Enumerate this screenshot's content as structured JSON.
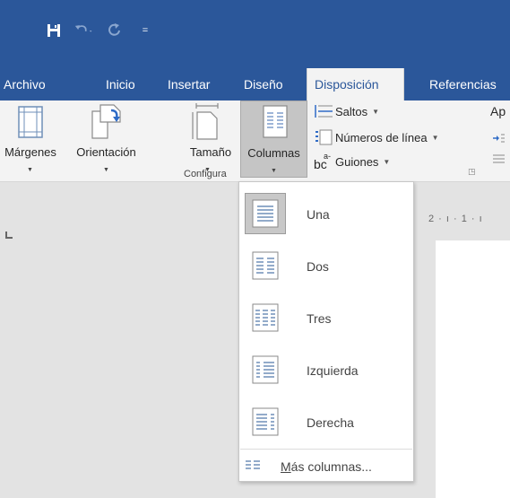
{
  "quick_access": {
    "icons": [
      "save-icon",
      "undo-icon",
      "redo-icon",
      "customize-icon"
    ],
    "customize_glyph": "="
  },
  "tabs": [
    "Archivo",
    "Inicio",
    "Insertar",
    "Diseño",
    "Disposición",
    "Referencias"
  ],
  "active_tab": "Disposición",
  "ribbon": {
    "margins": "Márgenes",
    "orientation": "Orientación",
    "size": "Tamaño",
    "columns": "Columnas",
    "breaks": "Saltos",
    "line_numbers": "Números de línea",
    "hyphenation": "Guiones",
    "hyphenation_icon_text": "bc",
    "hyphenation_icon_sup": "a-",
    "cut_next_label": "Ap",
    "group_label": "Configura"
  },
  "ruler": {
    "marks": "2 · ı · 1 · ı"
  },
  "columns_menu": {
    "options": [
      "Una",
      "Dos",
      "Tres",
      "Izquierda",
      "Derecha"
    ],
    "selected": "Una",
    "more": "Más columnas..."
  },
  "colors": {
    "brand": "#2b579a",
    "ribbon_bg": "#f3f3f3",
    "doc_bg": "#e3e3e3"
  }
}
